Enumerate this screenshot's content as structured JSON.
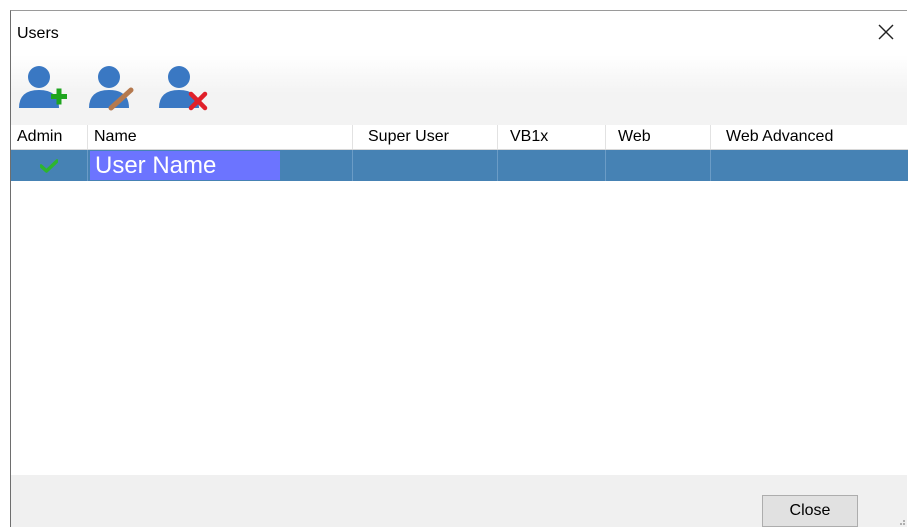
{
  "window": {
    "title": "Users",
    "close_icon": "close-x-icon"
  },
  "toolbar": {
    "add_user_icon": "add-user-icon",
    "edit_user_icon": "edit-user-icon",
    "delete_user_icon": "delete-user-icon"
  },
  "grid": {
    "columns": [
      "Admin",
      "Name",
      "Super User",
      "VB1x",
      "Web",
      "Web Advanced"
    ],
    "rows": [
      {
        "admin": true,
        "admin_icon": "check-icon",
        "name": "User Name",
        "super_user": "",
        "vb1x": "",
        "web": "",
        "web_advanced": ""
      }
    ]
  },
  "footer": {
    "close_label": "Close"
  },
  "colors": {
    "selected_row": "#4682b4",
    "edit_box": "#6c74ff",
    "check": "#2db52d",
    "user_icon": "#3a78c3",
    "add_icon": "#1fa51f",
    "delete_icon": "#e0202a",
    "edit_icon": "#b5794e"
  }
}
